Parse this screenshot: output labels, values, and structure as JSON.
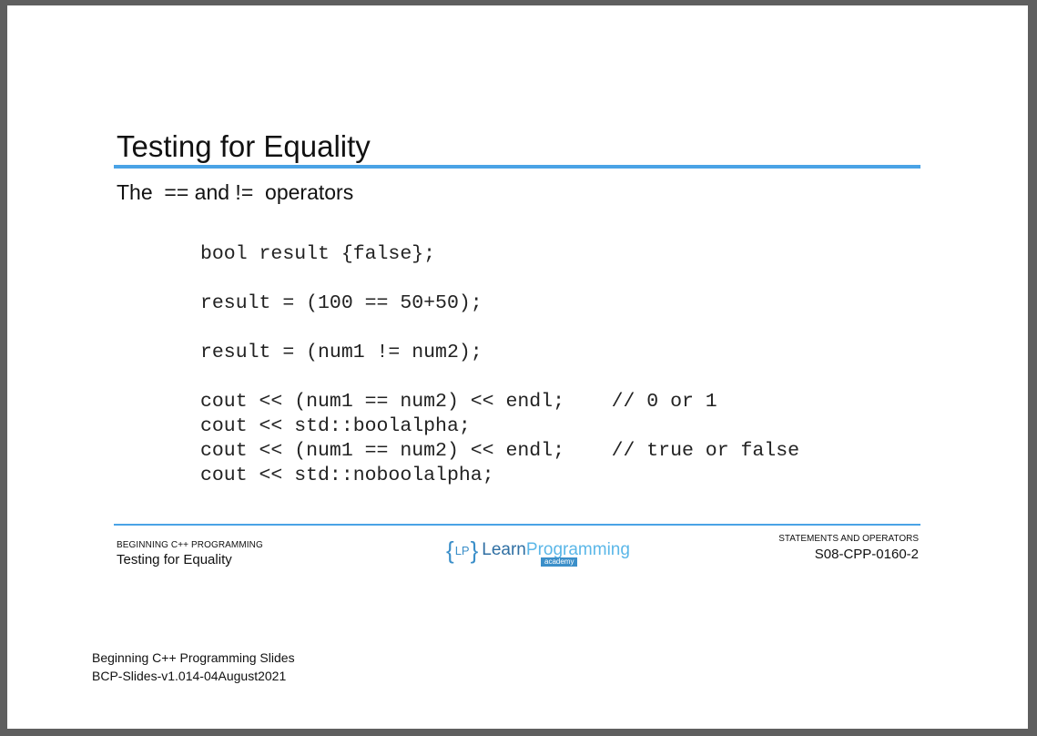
{
  "slide": {
    "title": "Testing for Equality",
    "subtitle": "The  == and !=  operators",
    "code": [
      "bool result {false};",
      "",
      "result = (100 == 50+50);",
      "",
      "result = (num1 != num2);",
      "",
      "cout << (num1 == num2) << endl;    // 0 or 1",
      "cout << std::boolalpha;",
      "cout << (num1 == num2) << endl;    // true or false",
      "cout << std::noboolalpha;"
    ]
  },
  "footer": {
    "course": "BEGINNING C++ PROGRAMMING",
    "topic": "Testing for Equality",
    "section": "STATEMENTS AND OPERATORS",
    "code": "S08-CPP-0160-2",
    "logo": {
      "brace_open": "{",
      "initials": "LP",
      "brace_close": "}",
      "learn": "Learn",
      "programming": "Programming",
      "academy": "academy"
    }
  },
  "note": {
    "line1": "Beginning C++ Programming Slides",
    "line2": "BCP-Slides-v1.014-04August2021"
  },
  "colors": {
    "accent": "#4aa3e6",
    "frame": "#5f5f5f"
  }
}
